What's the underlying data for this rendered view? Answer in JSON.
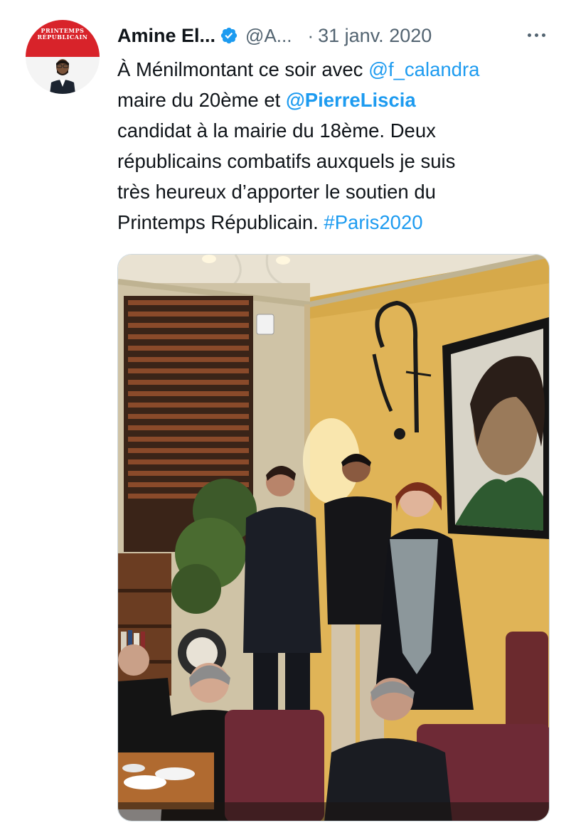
{
  "author": {
    "display_name": "Amine El...",
    "handle": "@A...",
    "avatar_brand": [
      "PRINTEMPS",
      "RÉPUBLICAIN"
    ]
  },
  "tweet": {
    "separator": "·",
    "date": "31 janv. 2020",
    "text": {
      "l1_a": "À Ménilmontant ce soir avec ",
      "l1_mention": "@f_calandra",
      "l2_a": "maire du 20ème et ",
      "l2_mention": "@PierreLiscia",
      "l3": "candidat à la mairie du 18ème. Deux",
      "l4": "républicains combatifs auxquels je suis",
      "l5": "très heureux d’apporter le soutien du",
      "l6_a": "Printemps Républicain. ",
      "l6_hashtag": "#Paris2020"
    }
  },
  "icons": {
    "verified": "verified-badge-icon",
    "more": "more-options-icon"
  },
  "colors": {
    "link": "#1d9bf0",
    "secondary_text": "#536471",
    "verified": "#1d9bf0",
    "brand_red": "#d8232a"
  }
}
